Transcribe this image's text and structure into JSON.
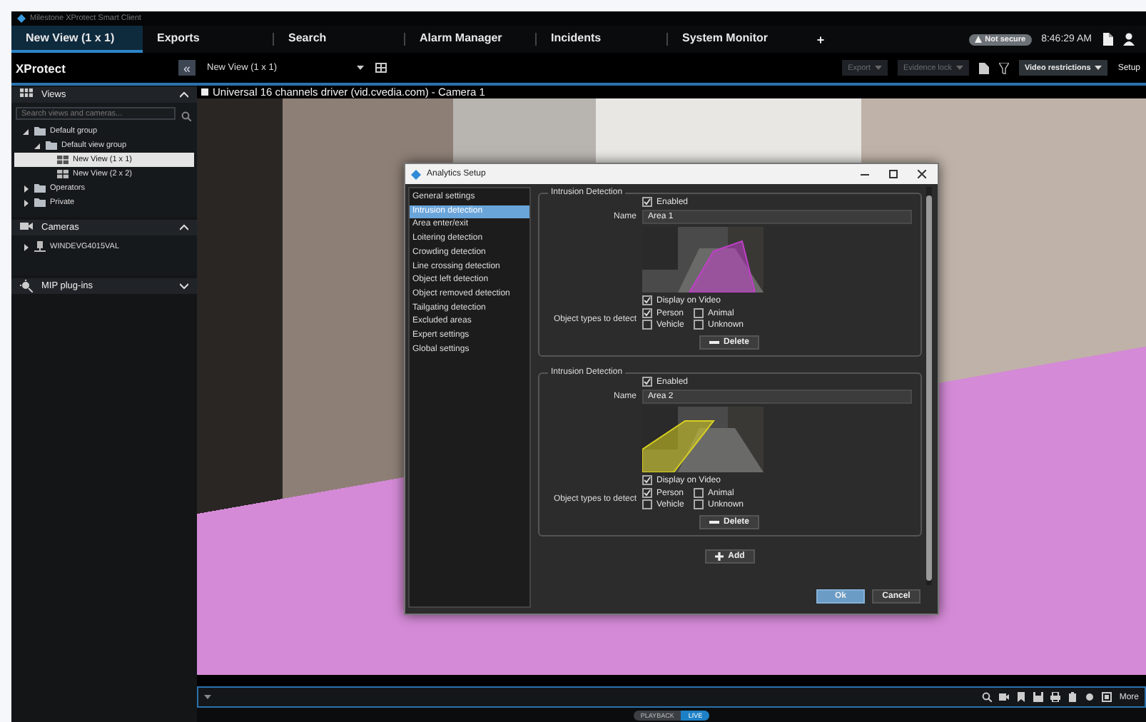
{
  "window": {
    "title": "Milestone XProtect Smart Client"
  },
  "tabs": [
    {
      "label": "New View (1 x 1)",
      "selected": true
    },
    {
      "label": "Exports",
      "selected": false
    },
    {
      "label": "Search",
      "selected": false
    },
    {
      "label": "Alarm Manager",
      "selected": false
    },
    {
      "label": "Incidents",
      "selected": false
    },
    {
      "label": "System Monitor",
      "selected": false
    }
  ],
  "new_tab": "+",
  "status": {
    "security": "Not secure",
    "time": "8:46:29 AM"
  },
  "toolbar": {
    "app_name": "XProtect",
    "collapse": "«",
    "view_select": "New View (1 x 1)",
    "actions": [
      {
        "label": "Export",
        "disabled": true
      },
      {
        "label": "Evidence lock",
        "disabled": true
      },
      {
        "label": "Video restrictions",
        "disabled": false
      }
    ],
    "setup": "Setup"
  },
  "sidebar": {
    "panels": [
      {
        "title": "Views",
        "kind": "views",
        "expanded": true,
        "search_placeholder": "Search views and cameras...",
        "tree": [
          {
            "label": "Default group",
            "kind": "folder",
            "expanded": true,
            "selected": false,
            "children": [
              {
                "label": "Default view group",
                "kind": "folder",
                "expanded": true,
                "selected": false,
                "children": [
                  {
                    "label": "New View (1 x 1)",
                    "kind": "view",
                    "selected": true
                  },
                  {
                    "label": "New View (2 x 2)",
                    "kind": "view",
                    "selected": false
                  }
                ]
              }
            ]
          },
          {
            "label": "Operators",
            "kind": "folder",
            "expanded": false,
            "selected": false
          },
          {
            "label": "Private",
            "kind": "folder",
            "expanded": false,
            "selected": false
          }
        ]
      },
      {
        "title": "Cameras",
        "kind": "cameras",
        "expanded": true,
        "tree": [
          {
            "label": "WINDEVG4015VAL",
            "kind": "server",
            "expanded": false,
            "selected": false
          }
        ]
      },
      {
        "title": "MIP plug-ins",
        "kind": "plugins",
        "expanded": false
      }
    ]
  },
  "viewer": {
    "camera_title": "Universal 16 channels driver (vid.cvedia.com) - Camera 1",
    "more": "More",
    "modes": [
      {
        "label": "PLAYBACK",
        "selected": false
      },
      {
        "label": "LIVE",
        "selected": true
      }
    ]
  },
  "dialog": {
    "title": "Analytics Setup",
    "nav": [
      {
        "label": "General settings",
        "selected": false
      },
      {
        "label": "Intrusion detection",
        "selected": true
      },
      {
        "label": "Area enter/exit",
        "selected": false
      },
      {
        "label": "Loitering detection",
        "selected": false
      },
      {
        "label": "Crowding detection",
        "selected": false
      },
      {
        "label": "Line crossing detection",
        "selected": false
      },
      {
        "label": "Object left detection",
        "selected": false
      },
      {
        "label": "Object removed detection",
        "selected": false
      },
      {
        "label": "Tailgating detection",
        "selected": false
      },
      {
        "label": "Excluded areas",
        "selected": false
      },
      {
        "label": "Expert settings",
        "selected": false
      },
      {
        "label": "Global settings",
        "selected": false
      }
    ],
    "areas": [
      {
        "legend": "Intrusion Detection",
        "enabled_label": "Enabled",
        "enabled": true,
        "name_label": "Name",
        "name": "Area 1",
        "color": "#c040c8",
        "display_label": "Display on Video",
        "display_on_video": true,
        "types_label": "Object types to detect",
        "types": [
          {
            "label": "Person",
            "checked": true
          },
          {
            "label": "Animal",
            "checked": false
          },
          {
            "label": "Vehicle",
            "checked": false
          },
          {
            "label": "Unknown",
            "checked": false
          }
        ],
        "delete": "Delete"
      },
      {
        "legend": "Intrusion Detection",
        "enabled_label": "Enabled",
        "enabled": true,
        "name_label": "Name",
        "name": "Area 2",
        "color": "#d8d020",
        "display_label": "Display on Video",
        "display_on_video": true,
        "types_label": "Object types to detect",
        "types": [
          {
            "label": "Person",
            "checked": true
          },
          {
            "label": "Animal",
            "checked": false
          },
          {
            "label": "Vehicle",
            "checked": false
          },
          {
            "label": "Unknown",
            "checked": false
          }
        ],
        "delete": "Delete"
      }
    ],
    "add": "Add",
    "ok": "Ok",
    "cancel": "Cancel"
  }
}
